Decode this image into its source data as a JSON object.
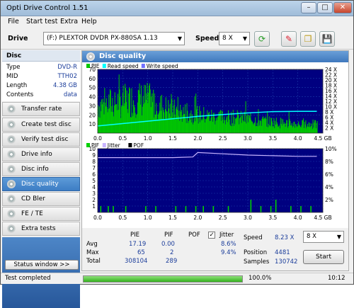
{
  "window": {
    "title": "Opti Drive Control 1.51"
  },
  "menu": [
    "File",
    "Start test",
    "Extra",
    "Help"
  ],
  "toolbar": {
    "drive_label": "Drive",
    "drive_value": "(F:)  PLEXTOR DVDR   PX-880SA 1.13",
    "speed_label": "Speed",
    "speed_value": "8 X"
  },
  "disc": {
    "header": "Disc",
    "rows": [
      {
        "key": "Type",
        "value": "DVD-R"
      },
      {
        "key": "MID",
        "value": "TTH02"
      },
      {
        "key": "Length",
        "value": "4.38 GB"
      },
      {
        "key": "Contents",
        "value": "data"
      }
    ]
  },
  "nav": [
    {
      "label": "Transfer rate",
      "selected": false
    },
    {
      "label": "Create test disc",
      "selected": false
    },
    {
      "label": "Verify test disc",
      "selected": false
    },
    {
      "label": "Drive info",
      "selected": false
    },
    {
      "label": "Disc info",
      "selected": false
    },
    {
      "label": "Disc quality",
      "selected": true
    },
    {
      "label": "CD Bler",
      "selected": false
    },
    {
      "label": "FE / TE",
      "selected": false
    },
    {
      "label": "Extra tests",
      "selected": false
    }
  ],
  "status_window_button": "Status window >>",
  "panel_title": "Disc quality",
  "chart_data": [
    {
      "type": "area",
      "legend": [
        "PIE",
        "Read speed",
        "Write speed"
      ],
      "x_ticks": [
        "0.0",
        "0.5",
        "1.0",
        "1.5",
        "2.0",
        "2.5",
        "3.0",
        "3.5",
        "4.0",
        "4.5 GB"
      ],
      "y_left_ticks": [
        "10",
        "20",
        "30",
        "40",
        "50",
        "60",
        "70"
      ],
      "y_right_ticks": [
        "2 X",
        "4 X",
        "6 X",
        "8 X",
        "10 X",
        "12 X",
        "14 X",
        "16 X",
        "18 X",
        "20 X",
        "22 X",
        "24 X"
      ],
      "xlim": [
        0,
        4.5
      ],
      "ylim": [
        0,
        70
      ],
      "y2lim": [
        0,
        24
      ],
      "pie_envelope": [
        [
          0.0,
          40
        ],
        [
          0.2,
          42
        ],
        [
          0.4,
          44
        ],
        [
          0.6,
          46
        ],
        [
          0.8,
          48
        ],
        [
          1.0,
          47
        ],
        [
          1.2,
          40
        ],
        [
          1.4,
          34
        ],
        [
          1.6,
          30
        ],
        [
          1.8,
          28
        ],
        [
          2.0,
          26
        ],
        [
          2.2,
          24
        ],
        [
          2.5,
          22
        ],
        [
          2.8,
          21
        ],
        [
          3.0,
          20
        ],
        [
          3.3,
          17
        ],
        [
          3.6,
          15
        ],
        [
          3.9,
          13
        ],
        [
          4.2,
          12
        ],
        [
          4.38,
          12
        ]
      ],
      "read_speed": [
        [
          0.0,
          2.7
        ],
        [
          0.5,
          3.6
        ],
        [
          1.0,
          4.5
        ],
        [
          1.5,
          5.4
        ],
        [
          2.0,
          6.3
        ],
        [
          2.5,
          7.0
        ],
        [
          3.0,
          7.6
        ],
        [
          3.5,
          8.1
        ],
        [
          4.0,
          8.2
        ],
        [
          4.38,
          8.2
        ]
      ],
      "colors": {
        "pie": "#00c800",
        "read": "#00ffff",
        "write": "#7070ff",
        "bg": "#000080"
      }
    },
    {
      "type": "bar",
      "legend": [
        "PIF",
        "Jitter",
        "POF"
      ],
      "x_ticks": [
        "0.0",
        "0.5",
        "1.0",
        "1.5",
        "2.0",
        "2.5",
        "3.0",
        "3.5",
        "4.0",
        "4.5 GB"
      ],
      "y_left_ticks": [
        "1",
        "2",
        "3",
        "4",
        "5",
        "6",
        "7",
        "8",
        "9",
        "10"
      ],
      "y_right_ticks": [
        "2%",
        "4%",
        "6%",
        "8%",
        "10%"
      ],
      "xlim": [
        0,
        4.5
      ],
      "ylim": [
        0,
        10
      ],
      "y2lim": [
        0,
        10
      ],
      "pif_spikes": [
        [
          0.05,
          1
        ],
        [
          0.2,
          1
        ],
        [
          0.3,
          1
        ],
        [
          0.55,
          1
        ],
        [
          0.95,
          1
        ],
        [
          1.15,
          1
        ],
        [
          1.55,
          1
        ],
        [
          1.75,
          1
        ],
        [
          1.95,
          1
        ],
        [
          2.1,
          1
        ],
        [
          2.3,
          1
        ],
        [
          2.6,
          1
        ],
        [
          3.05,
          2
        ],
        [
          3.25,
          1
        ],
        [
          3.45,
          1
        ],
        [
          3.55,
          2
        ],
        [
          3.85,
          1
        ],
        [
          4.05,
          1
        ],
        [
          4.25,
          1
        ]
      ],
      "jitter": [
        [
          0.0,
          8.6
        ],
        [
          0.5,
          8.6
        ],
        [
          1.0,
          8.6
        ],
        [
          1.5,
          8.6
        ],
        [
          1.9,
          8.7
        ],
        [
          2.0,
          9.4
        ],
        [
          2.5,
          9.2
        ],
        [
          3.0,
          9.0
        ],
        [
          3.5,
          8.9
        ],
        [
          4.0,
          8.8
        ],
        [
          4.38,
          8.8
        ]
      ],
      "colors": {
        "pif": "#00d000",
        "jitter": "#c8b4ff",
        "pof": "#000000",
        "bg": "#000080"
      }
    }
  ],
  "stats": {
    "headers": {
      "pie": "PIE",
      "pif": "PIF",
      "pof": "POF",
      "jitter": "Jitter"
    },
    "jitter_checked": true,
    "avg": {
      "label": "Avg",
      "pie": "17.19",
      "pif": "0.00",
      "jitter": "8.6%"
    },
    "max": {
      "label": "Max",
      "pie": "65",
      "pif": "2",
      "jitter": "9.4%"
    },
    "total": {
      "label": "Total",
      "pie": "308104",
      "pif": "289"
    },
    "speed_label": "Speed",
    "speed_value": "8.23 X",
    "speed_select": "8 X",
    "position_label": "Position",
    "position_value": "4481",
    "samples_label": "Samples",
    "samples_value": "130742",
    "start_button": "Start"
  },
  "status": {
    "text": "Test completed",
    "progress": 100.0,
    "progress_label": "100.0%",
    "time": "10:12"
  }
}
